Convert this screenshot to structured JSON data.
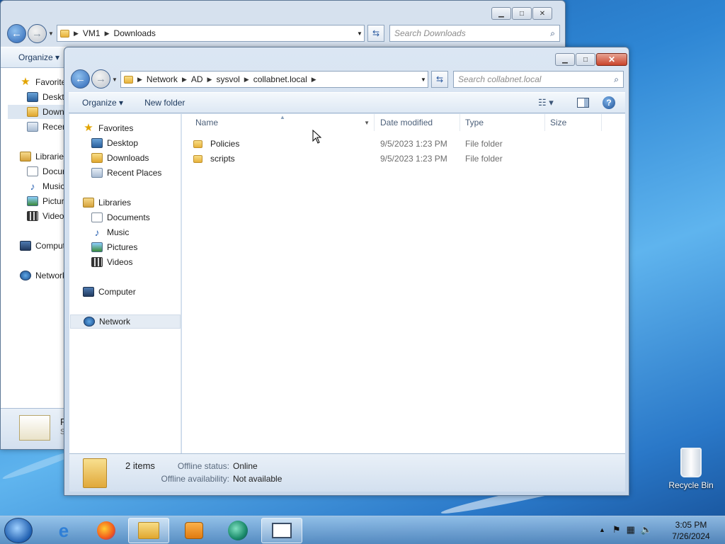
{
  "background_window": {
    "address": {
      "crumbs": [
        "VM1",
        "Downloads"
      ]
    },
    "search_placeholder": "Search Downloads",
    "toolbar": {
      "organize": "Organize"
    },
    "nav": [
      "Favorite",
      "Deskto",
      "Down",
      "Recen",
      "Librarie",
      "Docur",
      "Music",
      "Pictur",
      "Video",
      "Comput",
      "Network"
    ],
    "detail_p": "P",
    "detail_s": "S"
  },
  "window": {
    "address": {
      "crumbs": [
        "Network",
        "AD",
        "sysvol",
        "collabnet.local"
      ]
    },
    "search_placeholder": "Search collabnet.local",
    "toolbar": {
      "organize": "Organize",
      "new_folder": "New folder"
    },
    "nav": {
      "favorites": "Favorites",
      "desktop": "Desktop",
      "downloads": "Downloads",
      "recent": "Recent Places",
      "libraries": "Libraries",
      "documents": "Documents",
      "music": "Music",
      "pictures": "Pictures",
      "videos": "Videos",
      "computer": "Computer",
      "network": "Network"
    },
    "columns": {
      "name": "Name",
      "date": "Date modified",
      "type": "Type",
      "size": "Size"
    },
    "files": [
      {
        "name": "Policies",
        "date": "9/5/2023 1:23 PM",
        "type": "File folder"
      },
      {
        "name": "scripts",
        "date": "9/5/2023 1:23 PM",
        "type": "File folder"
      }
    ],
    "status": {
      "count": "2 items",
      "offline_status_label": "Offline status:",
      "offline_status_value": "Online",
      "offline_avail_label": "Offline availability:",
      "offline_avail_value": "Not available"
    }
  },
  "desktop": {
    "recycle_bin": "Recycle Bin"
  },
  "taskbar": {
    "time": "3:05 PM",
    "date": "7/26/2024"
  }
}
